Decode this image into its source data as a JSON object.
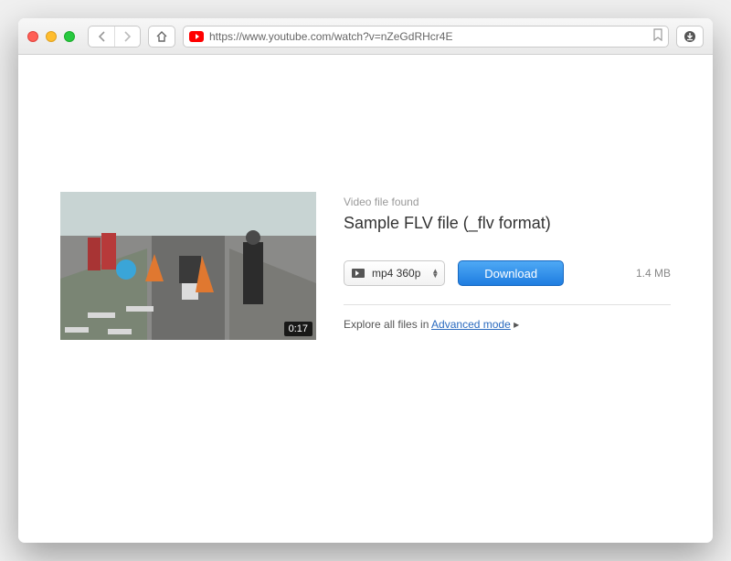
{
  "addressBar": {
    "url": "https://www.youtube.com/watch?v=nZeGdRHcr4E"
  },
  "video": {
    "duration": "0:17"
  },
  "info": {
    "foundLabel": "Video file found",
    "title": "Sample FLV file (_flv format)"
  },
  "formatSelect": {
    "label": "mp4 360p"
  },
  "downloadButton": {
    "label": "Download"
  },
  "fileSize": "1.4 MB",
  "explore": {
    "prefix": "Explore all files in ",
    "link": "Advanced mode",
    "suffix": " ▸"
  }
}
